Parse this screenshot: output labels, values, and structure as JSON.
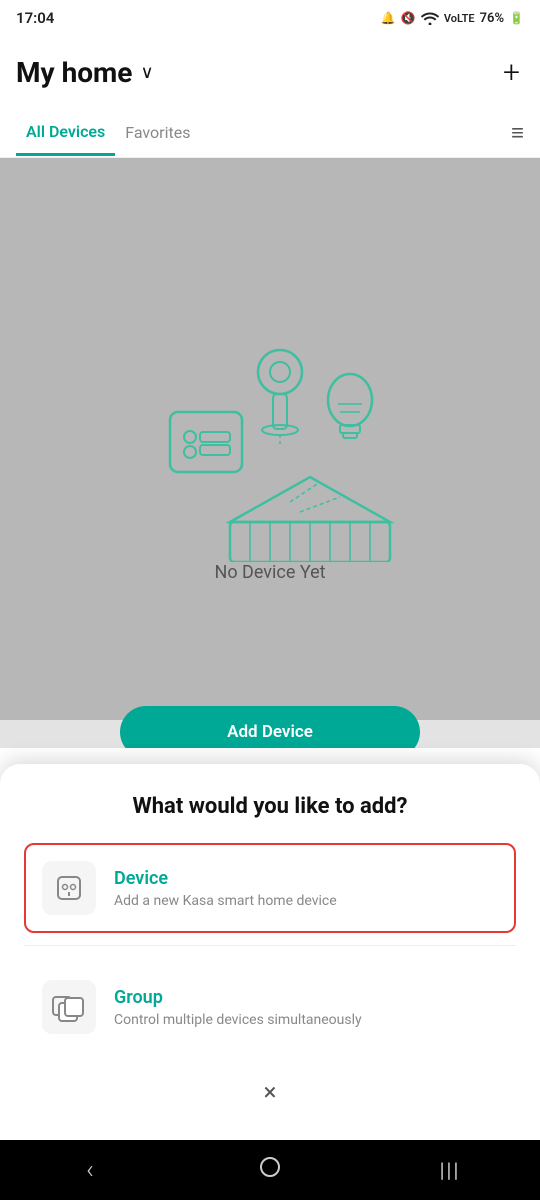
{
  "statusBar": {
    "time": "17:04",
    "battery": "76%",
    "icons": [
      "alarm",
      "mute",
      "wifi",
      "signal"
    ]
  },
  "header": {
    "title": "My home",
    "chevron": "∨",
    "addButton": "+"
  },
  "tabs": {
    "items": [
      {
        "label": "All Devices",
        "active": true
      },
      {
        "label": "Favorites",
        "active": false
      }
    ],
    "menuIcon": "≡"
  },
  "mainContent": {
    "noDeviceText": "No Device Yet",
    "addDeviceLabel": "Add Device"
  },
  "bottomSheet": {
    "title": "What would you like to add?",
    "options": [
      {
        "id": "device",
        "label": "Device",
        "description": "Add a new Kasa smart home device",
        "selected": true
      },
      {
        "id": "group",
        "label": "Group",
        "description": "Control multiple devices simultaneously",
        "selected": false
      }
    ],
    "closeLabel": "×"
  },
  "bottomNav": {
    "back": "‹",
    "home": "○",
    "recents": "|||"
  }
}
